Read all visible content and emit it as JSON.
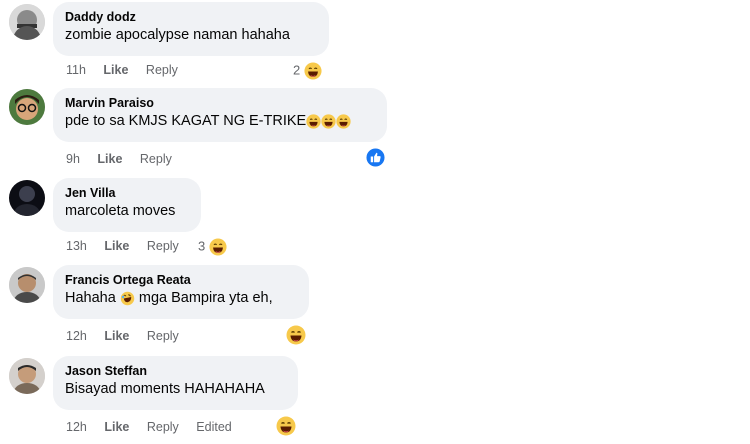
{
  "comments": [
    {
      "author": "Daddy dodz",
      "text": "zombie apocalypse naman hahaha",
      "time": "11h",
      "like": "Like",
      "reply": "Reply",
      "reaction_count": "2",
      "reaction_icon": "haha-emoji-icon"
    },
    {
      "author": "Marvin Paraiso",
      "text": "pde to sa KMJS KAGAT NG E-TRIKE",
      "time": "9h",
      "like": "Like",
      "reply": "Reply",
      "reaction_icon": "like-reaction-icon",
      "inline_emojis": [
        "haha-emoji-icon",
        "haha-emoji-icon",
        "haha-emoji-icon"
      ]
    },
    {
      "author": "Jen Villa",
      "text": "marcoleta moves",
      "time": "13h",
      "like": "Like",
      "reply": "Reply",
      "reaction_count": "3",
      "reaction_icon": "haha-emoji-icon"
    },
    {
      "author": "Francis Ortega Reata",
      "text_before_emoji": "Hahaha",
      "text_after_emoji": "mga Bampira yta eh,",
      "inline_emojis": [
        "rofl-emoji-icon"
      ],
      "time": "12h",
      "like": "Like",
      "reply": "Reply",
      "reaction_icon": "haha-emoji-icon"
    },
    {
      "author": "Jason Steffan",
      "text": "Bisayad moments HAHAHAHA",
      "time": "12h",
      "like": "Like",
      "reply": "Reply",
      "edited": "Edited",
      "reaction_icon": "haha-emoji-icon"
    }
  ],
  "colors": {
    "bubble": "#f0f2f5",
    "meta": "#65676b",
    "like_blue": "#1877f2",
    "haha_yellow": "#f7c94b"
  }
}
